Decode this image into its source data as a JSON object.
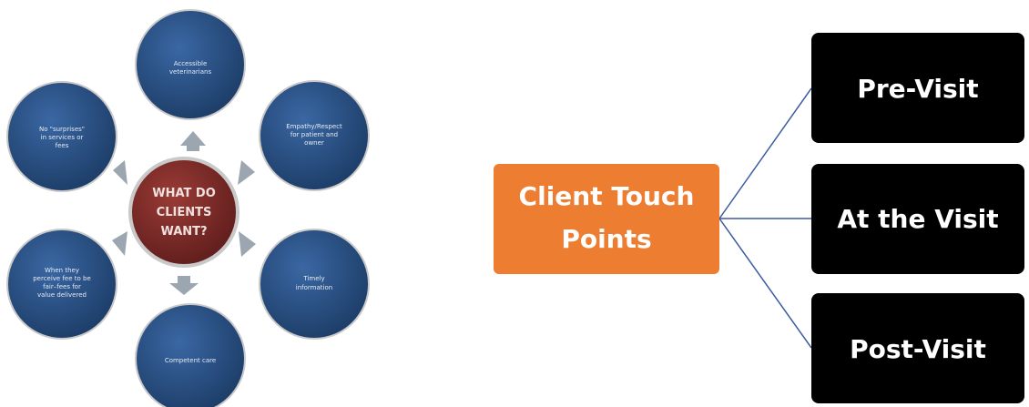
{
  "colors": {
    "outer_circle": "#234a7a",
    "center_circle": "#7a2a27",
    "arrow": "#9ba6b0",
    "touch_box": "#ed7d31",
    "stage_box": "#000000",
    "connector": "#3b5aa0"
  },
  "circle_diagram": {
    "center_lines": [
      "WHAT DO",
      "CLIENTS",
      "WANT?"
    ],
    "outer_items": [
      {
        "lines": [
          "Accessible",
          "veterinarians"
        ]
      },
      {
        "lines": [
          "Empathy/Respect",
          "for patient and",
          "owner"
        ]
      },
      {
        "lines": [
          "Timely",
          "information"
        ]
      },
      {
        "lines": [
          "Competent care"
        ]
      },
      {
        "lines": [
          "When they",
          "perceive fee to be",
          "fair–fees for",
          "value delivered"
        ]
      },
      {
        "lines": [
          "No \"surprises\"",
          "in services or",
          "fees"
        ]
      }
    ]
  },
  "touch_points": {
    "root_lines": [
      "Client Touch",
      "Points"
    ],
    "stages": [
      "Pre-Visit",
      "At the Visit",
      "Post-Visit"
    ]
  }
}
